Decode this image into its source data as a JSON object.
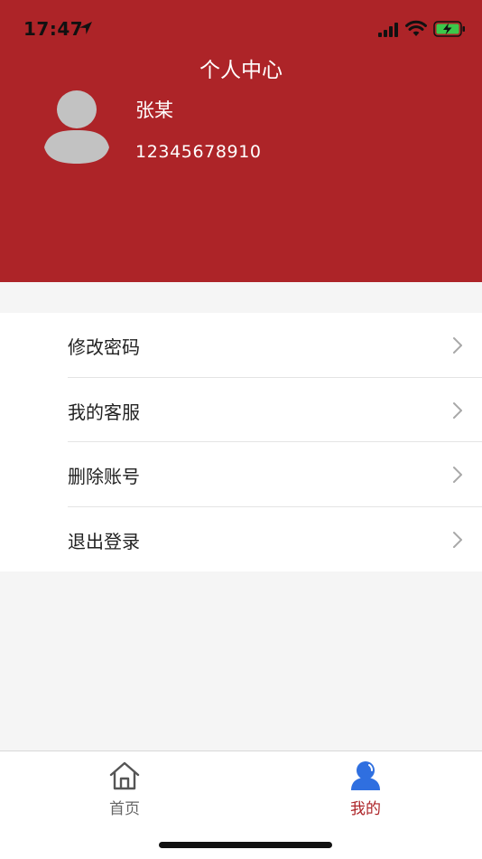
{
  "status_bar": {
    "time": "17:47",
    "icons": [
      "location-arrow-icon",
      "cellular-signal-icon",
      "wifi-icon",
      "battery-charging-icon"
    ],
    "battery_color": "#3cc84a"
  },
  "header": {
    "title": "个人中心",
    "background_color": "#ad2428",
    "user": {
      "avatar_icon": "default-avatar-icon",
      "name": "张某",
      "phone": "12345678910"
    }
  },
  "menu": {
    "items": [
      {
        "label": "修改密码",
        "icon": "chevron-right-icon"
      },
      {
        "label": "我的客服",
        "icon": "chevron-right-icon"
      },
      {
        "label": "删除账号",
        "icon": "chevron-right-icon"
      },
      {
        "label": "退出登录",
        "icon": "chevron-right-icon"
      }
    ]
  },
  "tabbar": {
    "tabs": [
      {
        "label": "首页",
        "icon": "home-icon",
        "active": false
      },
      {
        "label": "我的",
        "icon": "user-icon",
        "active": true
      }
    ],
    "active_color": "#ad2428",
    "active_icon_color": "#2f6fe0"
  }
}
